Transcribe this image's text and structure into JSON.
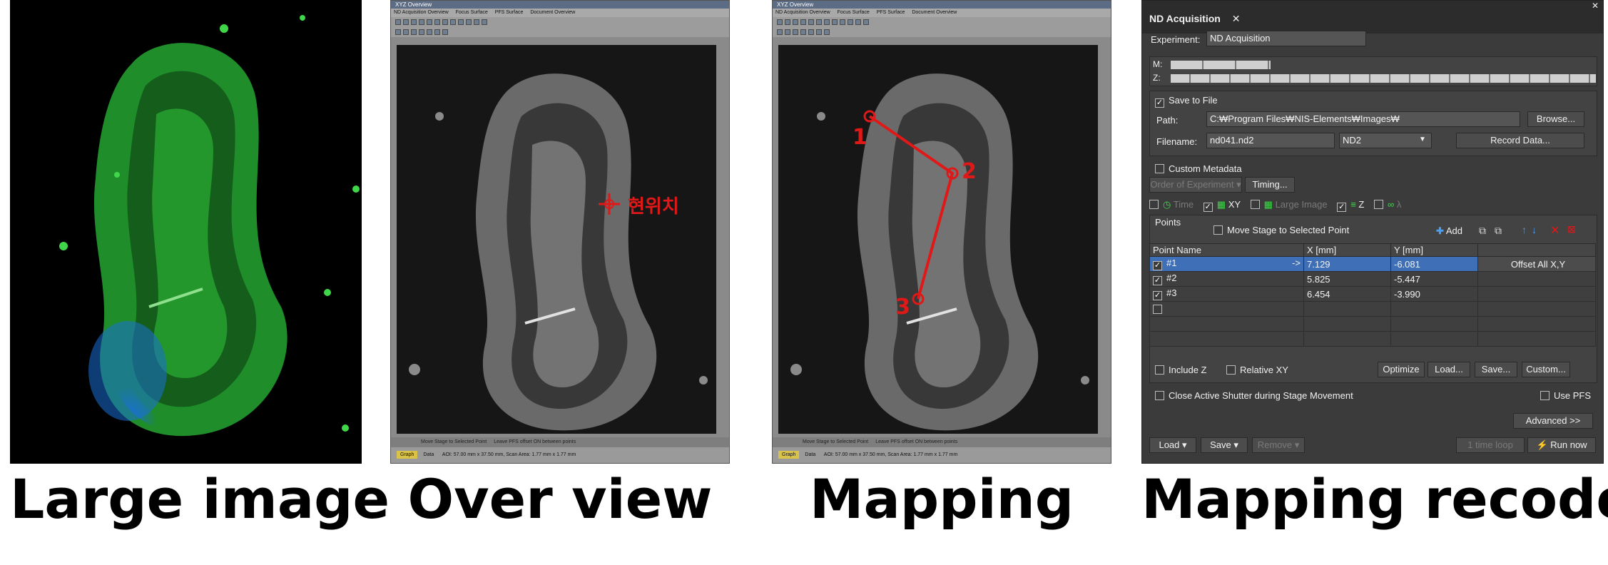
{
  "captions": [
    "Large image",
    "Over view",
    "Mapping",
    "Mapping recode"
  ],
  "overview": {
    "title": "XYZ Overview",
    "tabs": [
      "ND Acquisition Overview",
      "Focus Surface",
      "PFS Surface",
      "Document Overview"
    ],
    "current_position_label": "현위치",
    "footer_checks": [
      "Move Stage to Selected Point",
      "Leave PFS offset ON between points"
    ],
    "status_tabs": [
      "Graph",
      "Data"
    ],
    "status_text": "AOI: 57.00 mm x 37.50 mm, Scan Area: 1.77 mm x 1.77 mm"
  },
  "mapping": {
    "title": "XYZ Overview",
    "tabs": [
      "ND Acquisition Overview",
      "Focus Surface",
      "PFS Surface",
      "Document Overview"
    ],
    "point_labels": [
      "1",
      "2",
      "3"
    ],
    "footer_checks": [
      "Move Stage to Selected Point",
      "Leave PFS offset ON between points"
    ],
    "status_tabs": [
      "Graph",
      "Data"
    ],
    "status_text": "AOI: 57.00 mm x 37.50 mm, Scan Area: 1.77 mm x 1.77 mm"
  },
  "nd": {
    "title": "ND Acquisition",
    "experiment_label": "Experiment:",
    "experiment_value": "ND Acquisition",
    "m_label": "M:",
    "z_label": "Z:",
    "save_to_file": "Save to File",
    "path_label": "Path:",
    "path_value": "C:₩Program Files₩NIS-Elements₩Images₩",
    "browse": "Browse...",
    "filename_label": "Filename:",
    "filename_value": "nd041.nd2",
    "format_value": "ND2",
    "record_data": "Record Data...",
    "custom_metadata": "Custom Metadata",
    "order_of_experiment": "Order of Experiment",
    "timing": "Timing...",
    "dim_tabs": [
      "Time",
      "XY",
      "Large Image",
      "Z",
      "λ"
    ],
    "points_label": "Points",
    "move_stage": "Move Stage to Selected Point",
    "add": "Add",
    "columns": [
      "Point Name",
      "X [mm]",
      "Y [mm]"
    ],
    "rows": [
      {
        "name": "#1",
        "x": "7.129",
        "y": "-6.081"
      },
      {
        "name": "#2",
        "x": "5.825",
        "y": "-5.447"
      },
      {
        "name": "#3",
        "x": "6.454",
        "y": "-3.990"
      }
    ],
    "arrow": "->",
    "offset_all": "Offset All X,Y",
    "include_z": "Include Z",
    "relative_xy": "Relative XY",
    "optimize": "Optimize",
    "load_dots": "Load...",
    "save_dots": "Save...",
    "custom": "Custom...",
    "close_shutter": "Close Active Shutter during Stage Movement",
    "use_pfs": "Use PFS",
    "advanced": "Advanced >>",
    "load": "Load",
    "save": "Save",
    "remove": "Remove",
    "time_loop": "1 time loop",
    "run_now": "Run now"
  },
  "colors": {
    "accent_red": "#e01818",
    "selection_blue": "#3f6fb7",
    "tissue_green": "#2fc43a",
    "tissue_blue": "#1a6fd6"
  }
}
